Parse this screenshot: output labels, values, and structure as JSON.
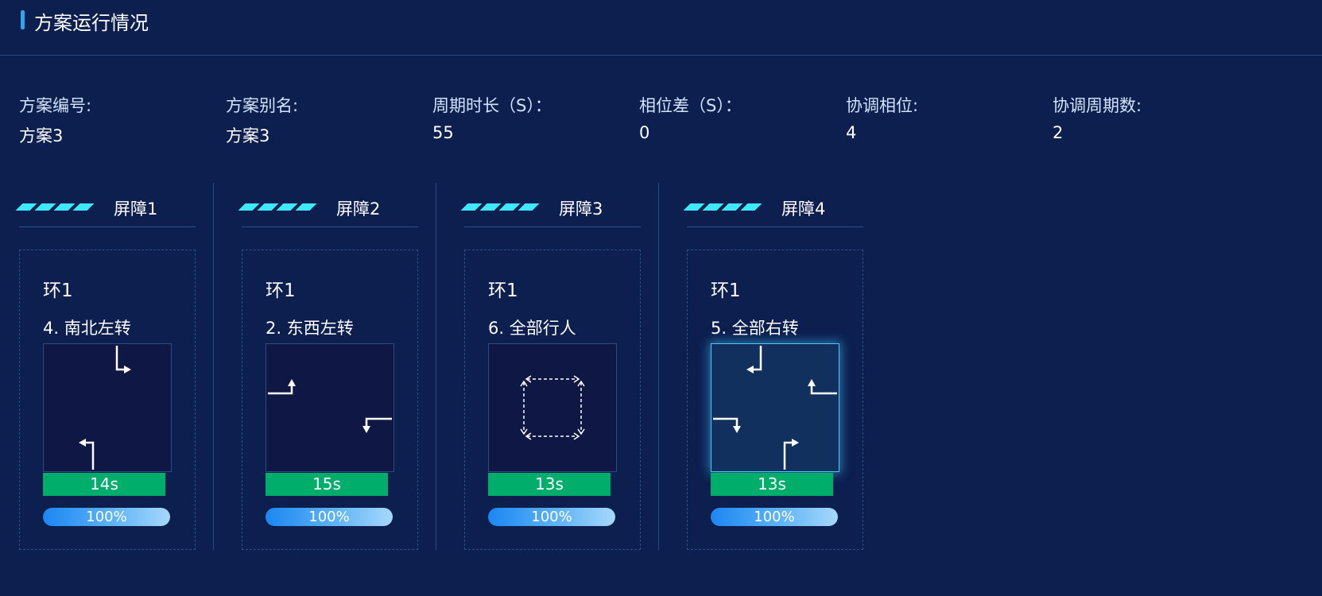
{
  "header": {
    "title": "方案运行情况"
  },
  "info": [
    {
      "label": "方案编号:",
      "value": "方案3"
    },
    {
      "label": "方案别名:",
      "value": "方案3"
    },
    {
      "label": "周期时长（S）：",
      "value": "55"
    },
    {
      "label": "相位差（S）：",
      "value": "0"
    },
    {
      "label": "协调相位:",
      "value": "4"
    },
    {
      "label": "协调周期数:",
      "value": "2"
    }
  ],
  "barriers": [
    {
      "title": "屏障1",
      "ring": "环1",
      "phase": "4. 南北左转",
      "time": "14s",
      "progress_text": "100%",
      "progress_percent": 100,
      "active": false
    },
    {
      "title": "屏障2",
      "ring": "环1",
      "phase": "2. 东西左转",
      "time": "15s",
      "progress_text": "100%",
      "progress_percent": 100,
      "active": false
    },
    {
      "title": "屏障3",
      "ring": "环1",
      "phase": "6. 全部行人",
      "time": "13s",
      "progress_text": "100%",
      "progress_percent": 100,
      "active": false
    },
    {
      "title": "屏障4",
      "ring": "环1",
      "phase": "5. 全部右转",
      "time": "13s",
      "progress_text": "100%",
      "progress_percent": 100,
      "active": true
    }
  ],
  "colors": {
    "background": "#0c1f4f",
    "accent": "#2ba7f0",
    "stripe": "#3ee8f8",
    "time_bar": "#00ad6b",
    "active_glow": "#46c8ff"
  }
}
